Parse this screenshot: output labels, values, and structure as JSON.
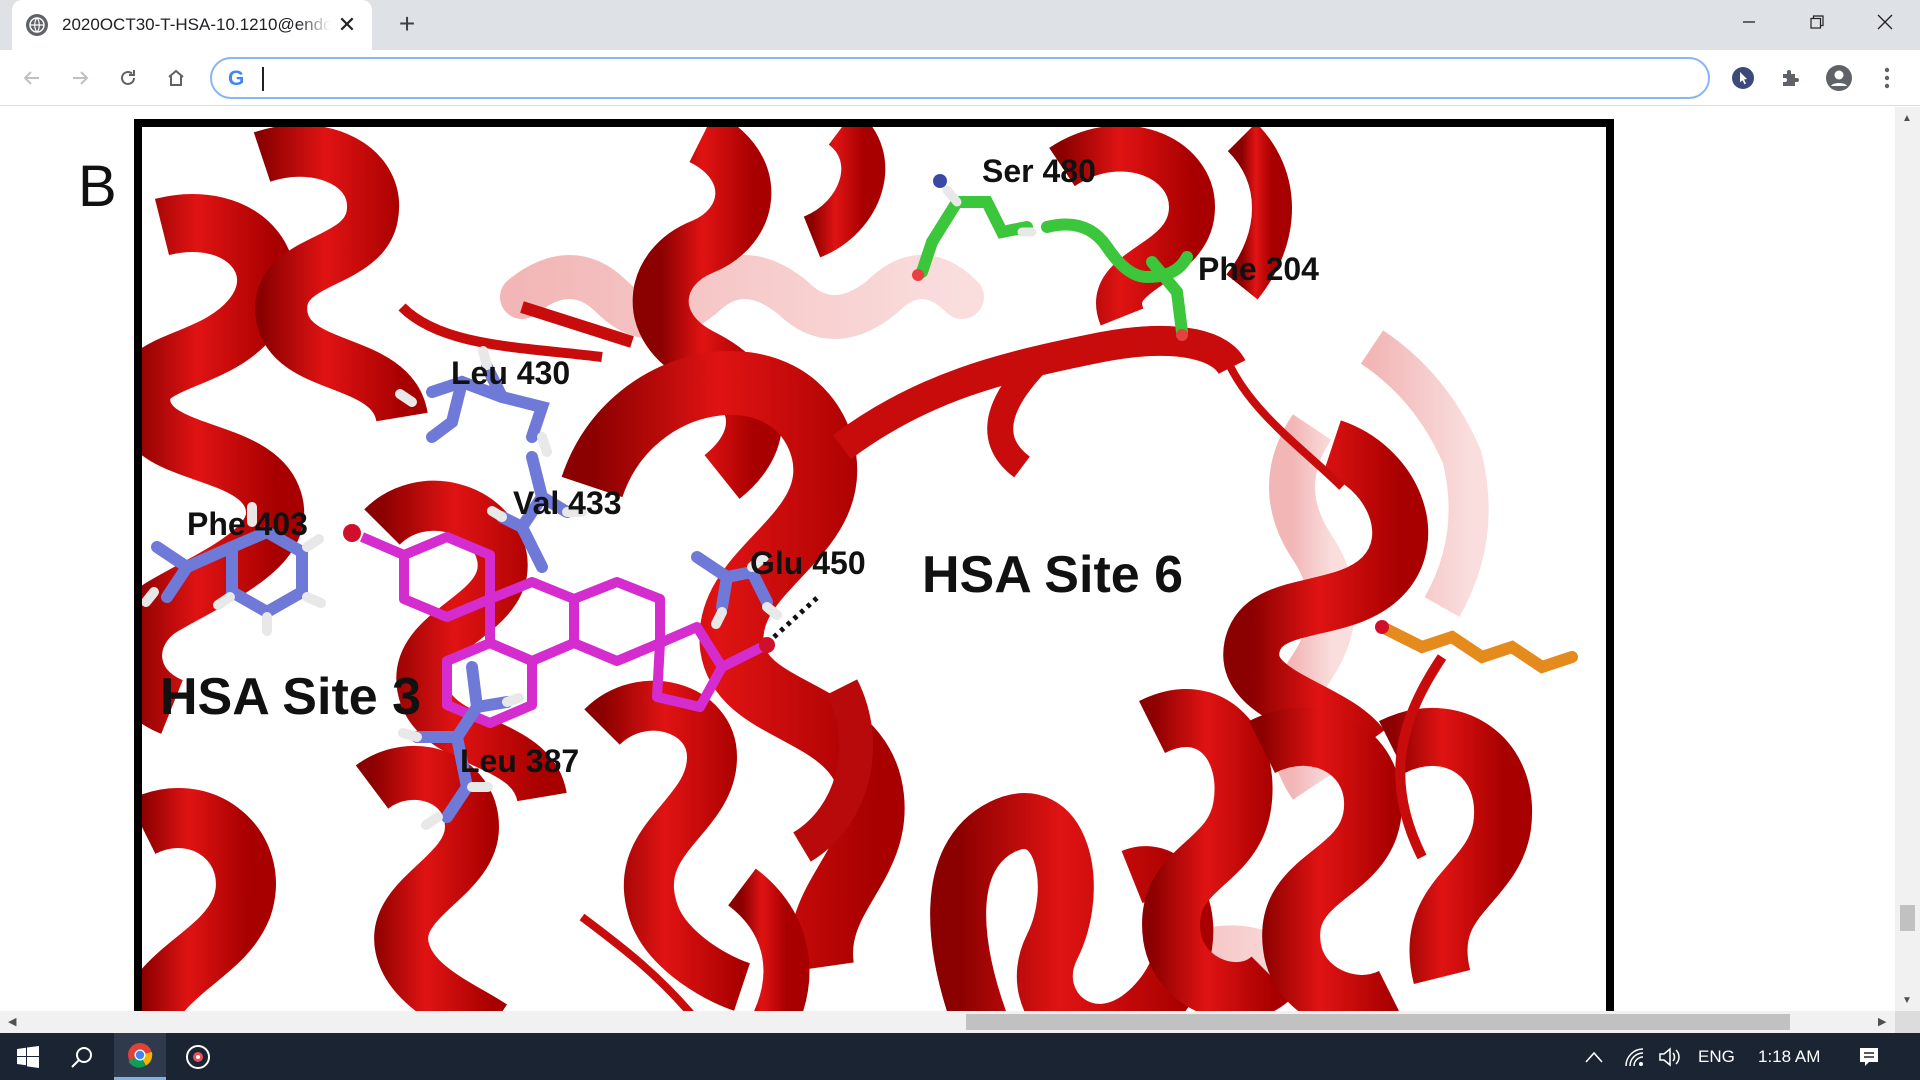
{
  "browser": {
    "tab_title": "2020OCT30-T-HSA-10.1210@endo",
    "tab_close": "✕",
    "new_tab": "+",
    "address_value": "",
    "google_mark": "G",
    "window": {
      "minimize": "—",
      "restore": "❐",
      "close": "✕"
    }
  },
  "figure": {
    "panel_label": "B",
    "labels": {
      "ser480": "Ser 480",
      "phe204": "Phe 204",
      "leu430": "Leu 430",
      "val433": "Val 433",
      "phe403": "Phe 403",
      "glu450": "Glu 450",
      "site6": "HSA Site 6",
      "site3": "HSA Site 3",
      "leu387": "Leu 387"
    },
    "colors": {
      "helix": "#d10f0f",
      "helix_dark": "#8b0000",
      "helix_light": "#f08a8a",
      "ligand": "#d42ccf",
      "residue_blue": "#6f79d8",
      "residue_green": "#3cc63c",
      "residue_orange": "#e58a1c"
    }
  },
  "taskbar": {
    "language": "ENG",
    "time": "1:18 AM"
  }
}
